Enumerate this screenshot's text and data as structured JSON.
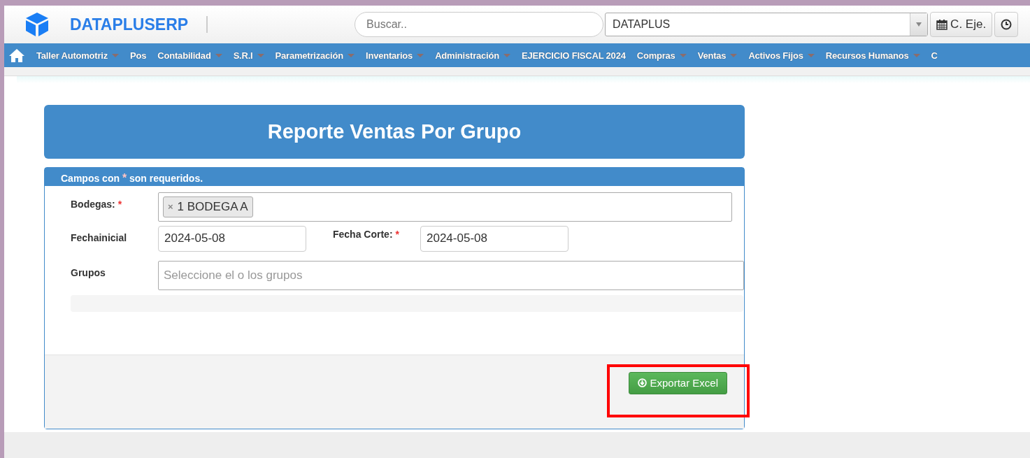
{
  "header": {
    "brand": "DATAPLUSERP",
    "search": {
      "placeholder": "Buscar.."
    },
    "company": {
      "value": "DATAPLUS"
    },
    "buttons": [
      {
        "label": "C. Eje."
      }
    ]
  },
  "menu": [
    {
      "label": "Taller Automotriz",
      "dropdown": true
    },
    {
      "label": "Pos",
      "dropdown": false
    },
    {
      "label": "Contabilidad",
      "dropdown": true
    },
    {
      "label": "S.R.I",
      "dropdown": true
    },
    {
      "label": "Parametrización",
      "dropdown": true
    },
    {
      "label": "Inventarios",
      "dropdown": true
    },
    {
      "label": "Administración",
      "dropdown": true
    },
    {
      "label": "EJERCICIO FISCAL 2024",
      "dropdown": false
    },
    {
      "label": "Compras",
      "dropdown": true
    },
    {
      "label": "Ventas",
      "dropdown": true
    },
    {
      "label": "Activos Fijos",
      "dropdown": true
    },
    {
      "label": "Recursos Humanos",
      "dropdown": true
    },
    {
      "label": "C",
      "dropdown": false
    }
  ],
  "report": {
    "title": "Reporte Ventas Por Grupo",
    "notice": {
      "before": "Campos con",
      "mark": "*",
      "after": "son requeridos."
    },
    "fields": {
      "bodegas": {
        "label": "Bodegas:",
        "required": true,
        "tags": [
          {
            "remove": "×",
            "label": "1 BODEGA A"
          }
        ]
      },
      "fecha_inicial": {
        "label": "Fechainicial",
        "required": false,
        "value": "2024-05-08"
      },
      "fecha_corte": {
        "label": "Fecha Corte:",
        "required": true,
        "value": "2024-05-08"
      },
      "grupos": {
        "label": "Grupos",
        "required": false,
        "placeholder": "Seleccione el o los grupos"
      }
    },
    "export_button": {
      "label": "Exportar Excel",
      "highlighted": true
    }
  }
}
